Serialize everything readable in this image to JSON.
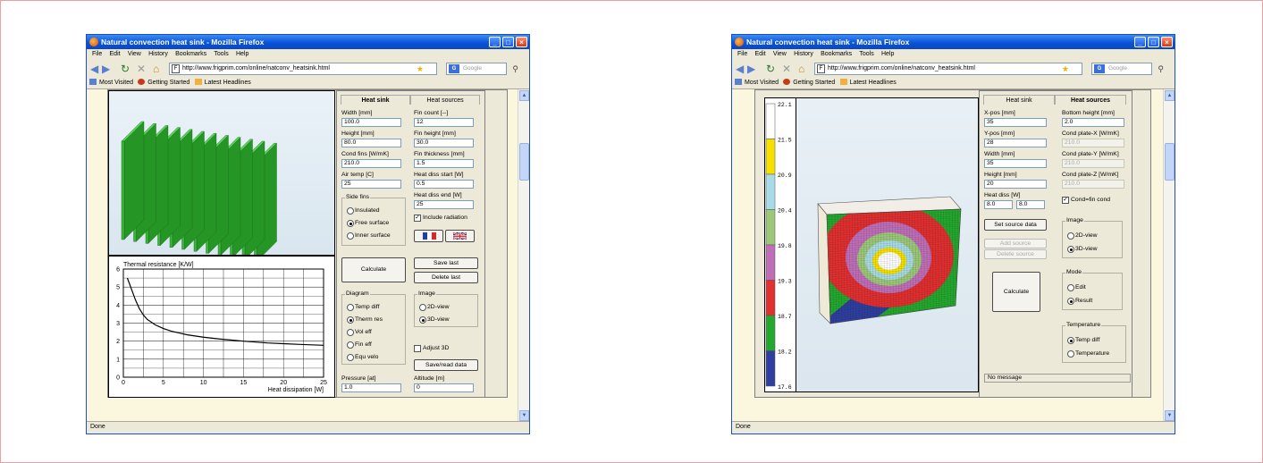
{
  "left_window": {
    "title": "Natural convection heat sink - Mozilla Firefox",
    "menu": [
      "File",
      "Edit",
      "View",
      "History",
      "Bookmarks",
      "Tools",
      "Help"
    ],
    "url": "http://www.frigprim.com/online/natconv_heatsink.html",
    "search_placeholder": "Google",
    "bookmarks": [
      "Most Visited",
      "Getting Started",
      "Latest Headlines"
    ],
    "status": "Done",
    "tabs": [
      "Heat sink",
      "Heat sources"
    ],
    "fields": [
      {
        "label": "Width [mm]",
        "value": "100.0"
      },
      {
        "label": "Fin count [--]",
        "value": "12"
      },
      {
        "label": "Height [mm]",
        "value": "80.0"
      },
      {
        "label": "Fin height [mm]",
        "value": "30.0"
      },
      {
        "label": "Cond fins [W/mK]",
        "value": "210.0"
      },
      {
        "label": "Fin thickness [mm]",
        "value": "1.5"
      },
      {
        "label": "Air temp [C]",
        "value": "25"
      },
      {
        "label": "Heat diss start [W]",
        "value": "0.5"
      },
      {
        "label": "Heat diss end [W]",
        "value": "25"
      }
    ],
    "side_fins": {
      "legend": "Side fins",
      "options": [
        "Insulated",
        "Free surface",
        "Inner surface"
      ],
      "selected": 1
    },
    "include_radiation": {
      "label": "Include radiation",
      "checked": true
    },
    "buttons": {
      "calculate": "Calculate",
      "save_last": "Save last",
      "delete_last": "Delete last",
      "save_read": "Save/read data"
    },
    "diagram": {
      "legend": "Diagram",
      "options": [
        "Temp diff",
        "Therm res",
        "Vol eff",
        "Fin eff",
        "Equ velo"
      ],
      "selected": 1
    },
    "image": {
      "legend": "Image",
      "options": [
        "2D-view",
        "3D-view"
      ],
      "selected": 1
    },
    "adjust_3d": {
      "label": "Adjust 3D",
      "checked": false
    },
    "pressure": {
      "label": "Pressure [at]",
      "value": "1.0"
    },
    "altitude": {
      "label": "Altitude [m]",
      "value": "0"
    },
    "colors": {
      "fin_face": "#3bb33b",
      "fin_side": "#259525",
      "fin_top": "#5ad35a"
    }
  },
  "chart_data": {
    "type": "line",
    "title": "Thermal resistance [K/W]",
    "xlabel": "Heat dissipation [W]",
    "ylabel": "Thermal resistance [K/W]",
    "xlim": [
      0,
      25
    ],
    "ylim": [
      0,
      6
    ],
    "x_ticks": [
      0,
      5,
      10,
      15,
      20,
      25
    ],
    "y_ticks": [
      0,
      1,
      2,
      3,
      4,
      5,
      6
    ],
    "grid": true,
    "series": [
      {
        "x": [
          0.5,
          1,
          1.5,
          2,
          2.5,
          3,
          4,
          5,
          6,
          7,
          8,
          10,
          12,
          15,
          18,
          20,
          22,
          25
        ],
        "y": [
          5.5,
          4.9,
          4.3,
          3.8,
          3.45,
          3.2,
          2.9,
          2.7,
          2.55,
          2.45,
          2.35,
          2.22,
          2.12,
          2.0,
          1.9,
          1.86,
          1.82,
          1.77
        ]
      }
    ]
  },
  "right_window": {
    "title": "Natural convection heat sink - Mozilla Firefox",
    "menu": [
      "File",
      "Edit",
      "View",
      "History",
      "Bookmarks",
      "Tools",
      "Help"
    ],
    "url": "http://www.frigprim.com/online/natconv_heatsink.html",
    "search_placeholder": "Google",
    "bookmarks": [
      "Most Visited",
      "Getting Started",
      "Latest Headlines"
    ],
    "status": "Done",
    "tabs": [
      "Heat sink",
      "Heat sources"
    ],
    "fields": [
      {
        "label": "X-pos [mm]",
        "value": "35"
      },
      {
        "label": "Bottom height [mm]",
        "value": "2.0"
      },
      {
        "label": "Y-pos [mm]",
        "value": "28"
      },
      {
        "label": "Cond plate-X [W/mK]",
        "value": "210.0"
      },
      {
        "label": "Width [mm]",
        "value": "35"
      },
      {
        "label": "Cond plate-Y [W/mK]",
        "value": "210.0"
      },
      {
        "label": "Height [mm]",
        "value": "20"
      },
      {
        "label": "Cond plate-Z [W/mK]",
        "value": "210.0"
      }
    ],
    "heat_diss": {
      "label": "Heat diss [W]",
      "value1": "8.0",
      "value2": "8.0"
    },
    "cond_fin": {
      "label": "Cond=fin cond",
      "checked": true
    },
    "buttons": {
      "set_source": "Set source data",
      "add_source": "Add source",
      "delete_source": "Delete source",
      "calculate": "Calculate"
    },
    "image": {
      "legend": "Image",
      "options": [
        "2D-view",
        "3D-view"
      ],
      "selected": 1
    },
    "mode": {
      "legend": "Mode",
      "options": [
        "Edit",
        "Result"
      ],
      "selected": 1
    },
    "temperature": {
      "legend": "Temperature",
      "options": [
        "Temp diff",
        "Temperature"
      ],
      "selected": 0
    },
    "message": "No message",
    "scale": {
      "labels": [
        "22.1",
        "21.5",
        "20.9",
        "20.4",
        "19.8",
        "19.3",
        "18.7",
        "18.2",
        "17.6"
      ],
      "colors": [
        "#ffffff",
        "#f5e000",
        "#a8dbe6",
        "#9cc87a",
        "#bf6fb7",
        "#e03030",
        "#25a82f",
        "#2f3f9f"
      ]
    }
  }
}
